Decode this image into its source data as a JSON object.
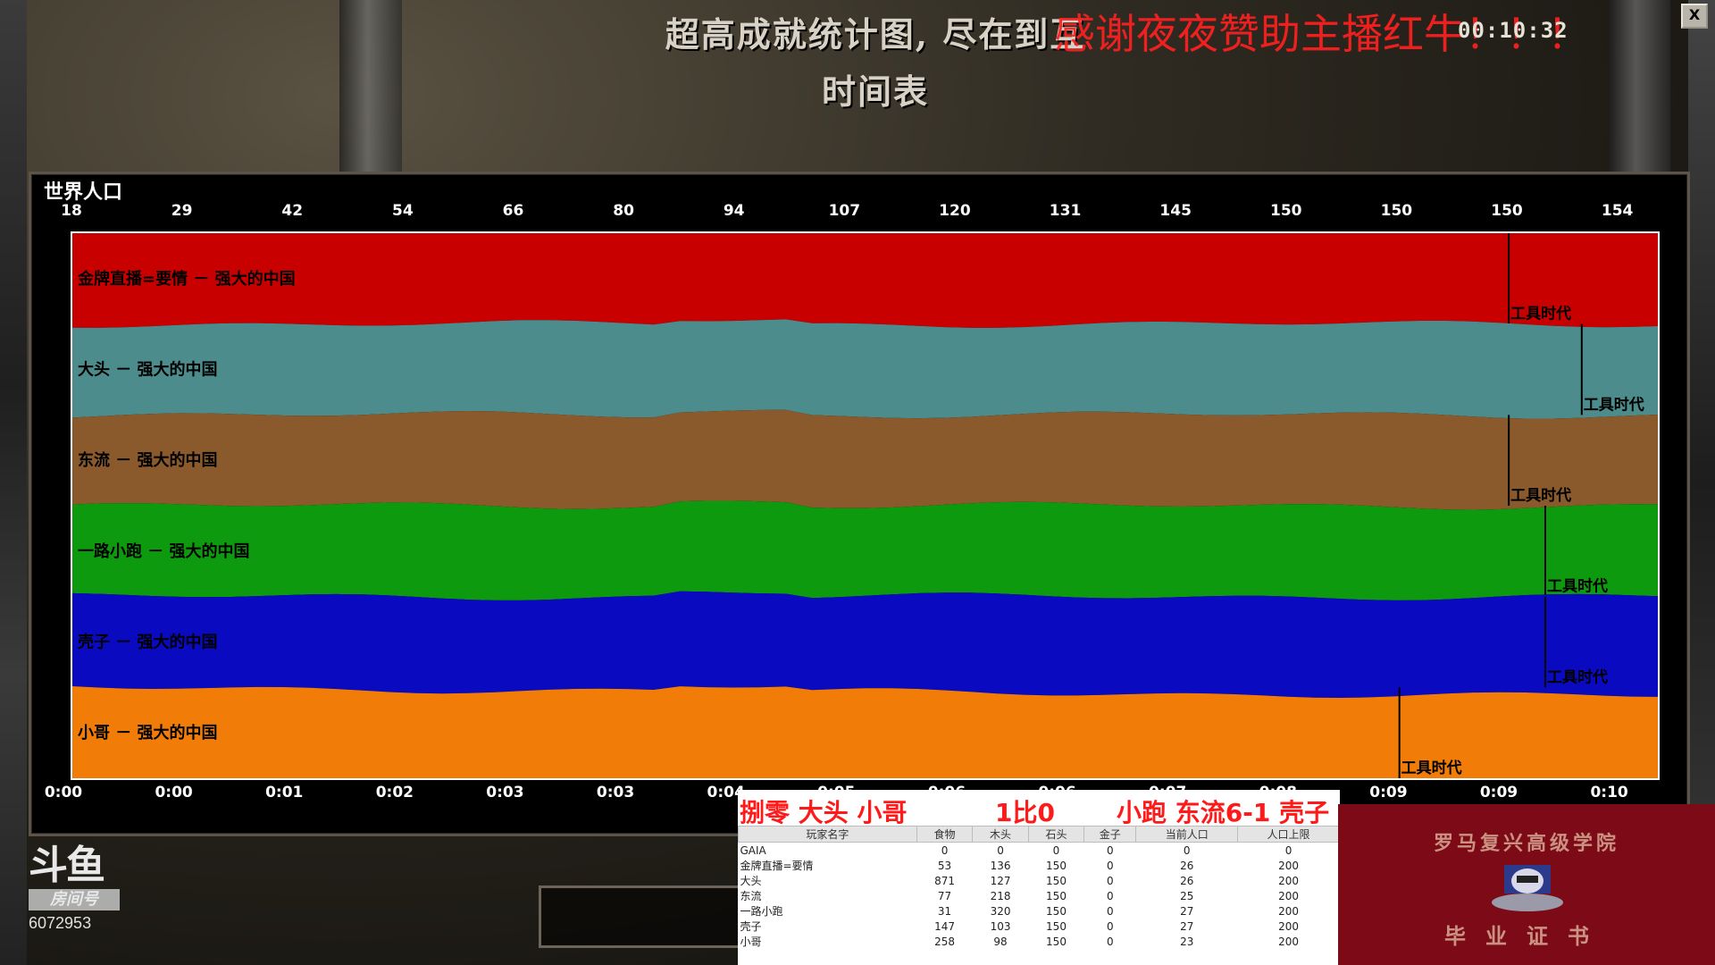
{
  "header": {
    "title": "超高成就统计图, 尽在到互",
    "subtitle": "时间表",
    "overlay_message": "感谢夜夜赞助主播红牛！！！",
    "clock": "00:10:32",
    "close_label": "X"
  },
  "chart_data": {
    "type": "area",
    "title": "世界人口",
    "top_axis_labels": [
      "18",
      "29",
      "42",
      "54",
      "66",
      "80",
      "94",
      "107",
      "120",
      "131",
      "145",
      "150",
      "150",
      "150",
      "154"
    ],
    "bottom_axis_labels": [
      "0:00",
      "0:00",
      "0:01",
      "0:02",
      "0:03",
      "0:03",
      "0:04",
      "0:05",
      "0:06",
      "0:06",
      "0:07",
      "0:08",
      "0:09",
      "0:09",
      "0:10"
    ],
    "series": [
      {
        "name": "金牌直播=要情 － 强大的中国",
        "color": "#c80000",
        "age_marker": "工具时代",
        "age_up_time": "0:09"
      },
      {
        "name": "大头 － 强大的中国",
        "color": "#4d8c8c",
        "age_marker": "工具时代",
        "age_up_time": "0:10"
      },
      {
        "name": "东流 － 强大的中国",
        "color": "#8a5a2c",
        "age_marker": "工具时代",
        "age_up_time": "0:09"
      },
      {
        "name": "一路小跑 － 强大的中国",
        "color": "#0e9a0e",
        "age_marker": "工具时代",
        "age_up_time": "0:09"
      },
      {
        "name": "壳子 － 强大的中国",
        "color": "#0a0ac0",
        "age_marker": "工具时代",
        "age_up_time": "0:09"
      },
      {
        "name": "小哥 － 强大的中国",
        "color": "#f17c08",
        "age_marker": "工具时代",
        "age_up_time": "0:08"
      }
    ]
  },
  "scoreboard": {
    "team_left": "捌零 大头 小哥",
    "score": "1比0",
    "team_right": "小跑 东流6-1 壳子",
    "columns": [
      "玩家名字",
      "食物",
      "木头",
      "石头",
      "金子",
      "当前人口",
      "人口上限"
    ],
    "rows": [
      [
        "GAIA",
        "0",
        "0",
        "0",
        "0",
        "0",
        "0"
      ],
      [
        "金牌直播=要情",
        "53",
        "136",
        "150",
        "0",
        "26",
        "200"
      ],
      [
        "大头",
        "871",
        "127",
        "150",
        "0",
        "26",
        "200"
      ],
      [
        "东流",
        "77",
        "218",
        "150",
        "0",
        "25",
        "200"
      ],
      [
        "一路小跑",
        "31",
        "320",
        "150",
        "0",
        "27",
        "200"
      ],
      [
        "壳子",
        "147",
        "103",
        "150",
        "0",
        "27",
        "200"
      ],
      [
        "小哥",
        "258",
        "98",
        "150",
        "0",
        "23",
        "200"
      ]
    ]
  },
  "badge": {
    "top_text": "罗马复兴高级学院",
    "bottom_text": "毕业证书"
  },
  "streamer": {
    "logo_text": "斗鱼",
    "room_label": "房间号",
    "room_id": "6072953"
  }
}
